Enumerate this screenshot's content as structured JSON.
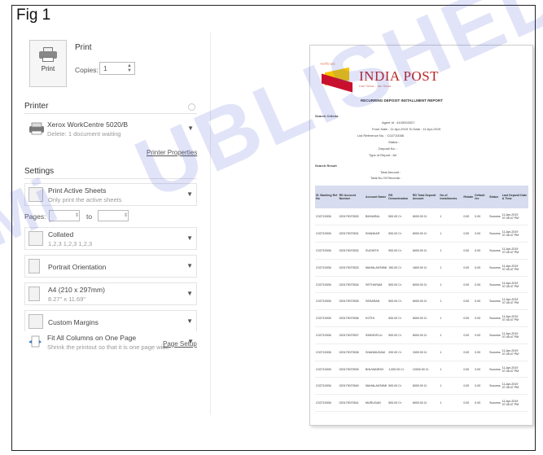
{
  "figure_label": "Fig 1",
  "watermark": {
    "line1": "UBLISHED",
    "line2": "Mi"
  },
  "print": {
    "button_label": "Print",
    "title": "Print",
    "copies_label": "Copies:",
    "copies_value": "1"
  },
  "printer": {
    "section_title": "Printer",
    "name": "Xerox WorkCentre 5020/B",
    "status": "Delete: 1 document waiting",
    "properties_link": "Printer Properties"
  },
  "settings": {
    "section_title": "Settings",
    "scope": {
      "title": "Print Active Sheets",
      "subtitle": "Only print the active sheets"
    },
    "pages_label": "Pages:",
    "to_label": "to",
    "collation": {
      "title": "Collated",
      "subtitle": "1,2,3   1,2,3   1,2,3"
    },
    "orientation": {
      "title": "Portrait Orientation"
    },
    "paper": {
      "title": "A4 (210 x 297mm)",
      "subtitle": "8.27\" x 11.69\""
    },
    "margins": {
      "title": "Custom Margins"
    },
    "scaling": {
      "title": "Fit All Columns on One Page",
      "subtitle": "Shrink the printout so that it is one page wide"
    },
    "page_setup_link": "Page Setup"
  },
  "preview": {
    "logo_small": "भारतीय डाक",
    "logo_text": "INDIA POST",
    "logo_sub": "Dak Sewa - Jan Sewa",
    "report_title": "RECURRING DEPOSIT INSTALLMENT REPORT",
    "search_criteria_label": "Search Criteria",
    "fields": [
      "Agent Id : 4100002027",
      "From Date : 11-Apr-2019 To Date : 11-Apr-2019",
      "List Reference No. : C02710006",
      "Status :",
      "Deposit No. :",
      "Type of Report : All"
    ],
    "search_result_label": "Search Result",
    "totals": [
      "Total Amount :",
      "Total No Of Records :"
    ],
    "table_headers": [
      "Sl. Banking Ref No",
      "RD Account Number",
      "Account Name",
      "RD Denomination",
      "RD Total Deposit Amount",
      "No of Installments",
      "Rebate",
      "Default fee",
      "Status",
      "Last Deposit Date & Time"
    ],
    "rows": [
      [
        "C02710006",
        "020179070530",
        "BIKHARAL",
        "500.00 Cr",
        "6000.00 Cr",
        "1",
        "0.00",
        "0.00",
        "Success",
        "11-Apr-2019 07:45:47 PM"
      ],
      [
        "C02710006",
        "020179070531",
        "SHANKAR",
        "500.00 Cr",
        "6000.00 Cr",
        "1",
        "0.00",
        "0.00",
        "Success",
        "11-Apr-2019 07:45:47 PM"
      ],
      [
        "C02710006",
        "020179070532",
        "SUGHITH",
        "500.00 Cr",
        "6000.00 Cr",
        "1",
        "0.00",
        "0.00",
        "Success",
        "11-Apr-2019 07:45:47 PM"
      ],
      [
        "C02710006",
        "020179070533",
        "MAHALAKSHMI",
        "150.00 Cr",
        "1800.00 Cr",
        "1",
        "0.00",
        "0.00",
        "Success",
        "11-Apr-2019 07:45:47 PM"
      ],
      [
        "C02710006",
        "020179070534",
        "SETHURAM",
        "500.00 Cr",
        "6000.00 Cr",
        "1",
        "0.00",
        "0.00",
        "Success",
        "11-Apr-2019 07:45:47 PM"
      ],
      [
        "C02710006",
        "020179070535",
        "SEKARAN",
        "500.00 Cr",
        "6000.00 Cr",
        "1",
        "0.00",
        "0.00",
        "Success",
        "11-Apr-2019 07:45:47 PM"
      ],
      [
        "C02710006",
        "020179070536",
        "KOTHI",
        "500.00 Cr",
        "6000.00 Cr",
        "1",
        "0.00",
        "0.00",
        "Success",
        "11-Apr-2019 07:45:47 PM"
      ],
      [
        "C02710006",
        "020179070537",
        "SINDEVELU",
        "500.00 Cr",
        "6000.00 Cr",
        "1",
        "0.00",
        "0.00",
        "Success",
        "11-Apr-2019 07:45:47 PM"
      ],
      [
        "C02710006",
        "020179070538",
        "SHANMUGAM",
        "200.00 Cr",
        "2400.00 Cr",
        "1",
        "0.00",
        "0.00",
        "Success",
        "11-Apr-2019 07:45:47 PM"
      ],
      [
        "C02710006",
        "020179070539",
        "BHUVANESH",
        "1,000.00 Cr",
        "12000.00 Cr",
        "1",
        "0.00",
        "0.00",
        "Success",
        "11-Apr-2019 07:45:47 PM"
      ],
      [
        "C02710006",
        "020179070540",
        "MAHALAKSHMI",
        "500.00 Cr",
        "6000.00 Cr",
        "1",
        "0.00",
        "0.00",
        "Success",
        "11-Apr-2019 07:45:47 PM"
      ],
      [
        "C02710006",
        "020179070541",
        "MURUGAN",
        "500.00 Cr",
        "6000.00 Cr",
        "1",
        "0.00",
        "0.00",
        "Success",
        "11-Apr-2019 07:45:47 PM"
      ]
    ]
  },
  "colors": {
    "accent_red": "#c8102e",
    "accent_yellow": "#f4c400",
    "table_header": "#d7dcef"
  }
}
